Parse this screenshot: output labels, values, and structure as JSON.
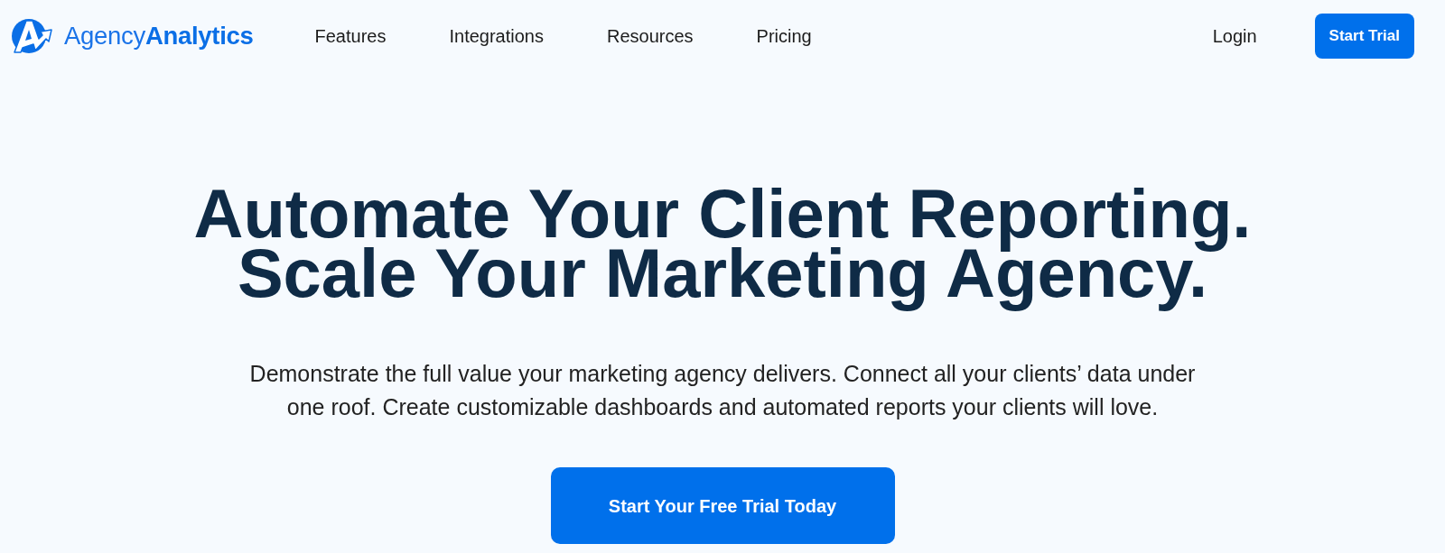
{
  "header": {
    "logo": {
      "wordmark": "Agency**Analytics**"
    },
    "nav": [
      {
        "label": "Features"
      },
      {
        "label": "Integrations"
      },
      {
        "label": "Resources"
      },
      {
        "label": "Pricing"
      }
    ],
    "login": "Login",
    "start_trial": "Start Trial"
  },
  "hero": {
    "headline": [
      "Automate Your Client Reporting.",
      "Scale Your Marketing Agency."
    ],
    "description": "Demonstrate the full value your marketing agency delivers. Connect all your clients’ data under one roof. Create customizable dashboards and automated reports your clients will love.",
    "cta": "Start Your Free Trial Today"
  }
}
